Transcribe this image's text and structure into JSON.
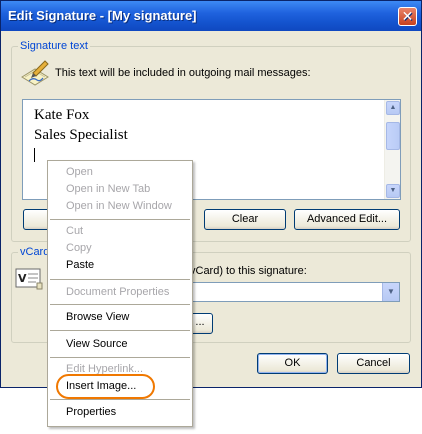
{
  "window": {
    "title": "Edit Signature - [My signature]",
    "close_glyph": "✕"
  },
  "signature_group": {
    "label": "Signature text",
    "description": "This text will be included in outgoing mail messages:",
    "icon": "signature-pen-icon"
  },
  "editor": {
    "lines": [
      "Kate Fox",
      "Sales Specialist"
    ]
  },
  "buttons": {
    "clear": "Clear",
    "advanced_edit": "Advanced Edit...",
    "ok": "OK",
    "cancel": "Cancel",
    "ellipsis": "..."
  },
  "vcard_group": {
    "label": "vCard",
    "label_fragment": "vCard) to this signature:",
    "icon": "vcard-icon"
  },
  "context_menu": {
    "open": "Open",
    "open_new_tab": "Open in New Tab",
    "open_new_window": "Open in New Window",
    "cut": "Cut",
    "copy": "Copy",
    "paste": "Paste",
    "document_properties": "Document Properties",
    "browse_view": "Browse View",
    "view_source": "View Source",
    "edit_hyperlink": "Edit Hyperlink...",
    "insert_image": "Insert Image...",
    "properties": "Properties"
  },
  "colors": {
    "titlebar": "#1f62de",
    "dialog_bg": "#ece9d8",
    "group_label": "#0046d5",
    "highlight_ring": "#f07800",
    "disabled_text": "#a7a6aa"
  }
}
